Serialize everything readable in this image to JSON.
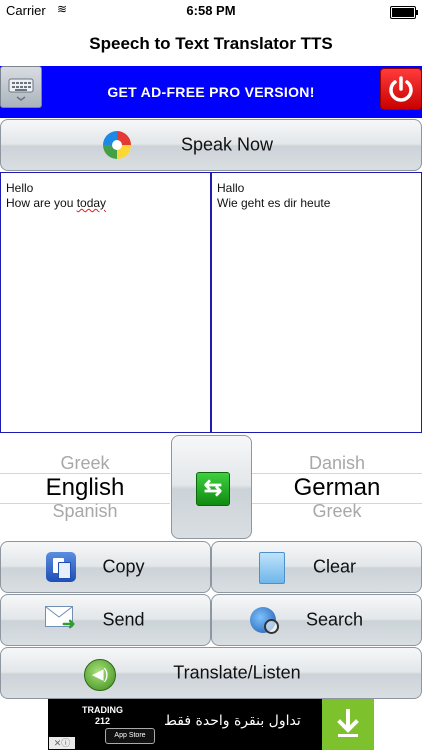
{
  "status_bar": {
    "carrier": "Carrier",
    "time": "6:58 PM"
  },
  "nav": {
    "title": "Speech to Text Translator TTS"
  },
  "banner": {
    "label": "GET AD-FREE PRO VERSION!",
    "keyboard_icon": "keyboard-icon",
    "power_icon": "power-icon"
  },
  "speak": {
    "label": "Speak Now",
    "icon": "microphone-orb-icon"
  },
  "source_text": {
    "line1": "Hello",
    "line2_before": "How are you ",
    "line2_misspelled": "today"
  },
  "target_text": {
    "line1": "Hallo",
    "line2": "Wie geht es dir heute"
  },
  "left_picker": {
    "above": "Greek",
    "selected": "English",
    "below": "Spanish"
  },
  "right_picker": {
    "above": "Danish",
    "selected": "German",
    "below": "Greek"
  },
  "buttons": {
    "copy": "Copy",
    "clear": "Clear",
    "send": "Send",
    "search": "Search",
    "translate": "Translate/Listen"
  },
  "ad": {
    "brand_line1": "TRADING",
    "brand_line2": "212",
    "store_badge": "App Store",
    "arabic_text": "تداول بنقرة واحدة فقط"
  },
  "colors": {
    "banner": "#0000ff",
    "pane_border": "#1c1cb0",
    "power": "#e00000",
    "download": "#7dc22c"
  }
}
